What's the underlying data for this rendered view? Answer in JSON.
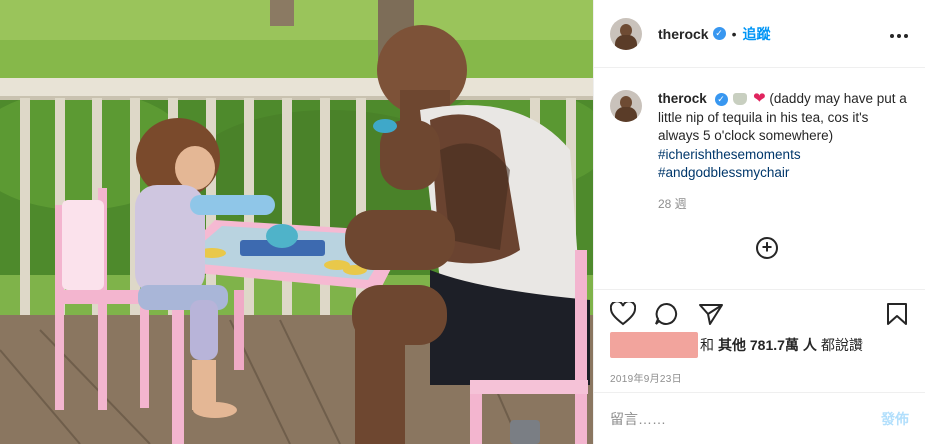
{
  "post": {
    "username": "therock",
    "verified_mark": "✓",
    "separator": "•",
    "follow_label": "追蹤",
    "more_label": "•••"
  },
  "caption": {
    "username": "therock",
    "text": "(daddy may have put a little nip of tequila in his tea, cos it's always 5 o'clock somewhere)",
    "hashtags": [
      "#icherishthesemoments",
      "#andgodblessmychair"
    ],
    "time_ago": "28 週",
    "emoji_heart": "❤"
  },
  "load_more_label": "+",
  "likes": {
    "prefix": "和",
    "count_text": "其他 781.7萬 人",
    "suffix": "都說讚"
  },
  "date": "2019年9月23日",
  "comment": {
    "placeholder": "留言……",
    "post_label": "發佈"
  },
  "icons": [
    "heart-icon",
    "comment-icon",
    "share-icon",
    "bookmark-icon",
    "more-icon",
    "plus-circle-icon",
    "verified-badge-icon"
  ],
  "colors": {
    "link_blue": "#0095f6",
    "hashtag_blue": "#00376b",
    "verified_blue": "#3897f0",
    "muted_gray": "#8e8e8e",
    "disabled_post": "#b2dffc",
    "redaction": "#f2a49d"
  }
}
